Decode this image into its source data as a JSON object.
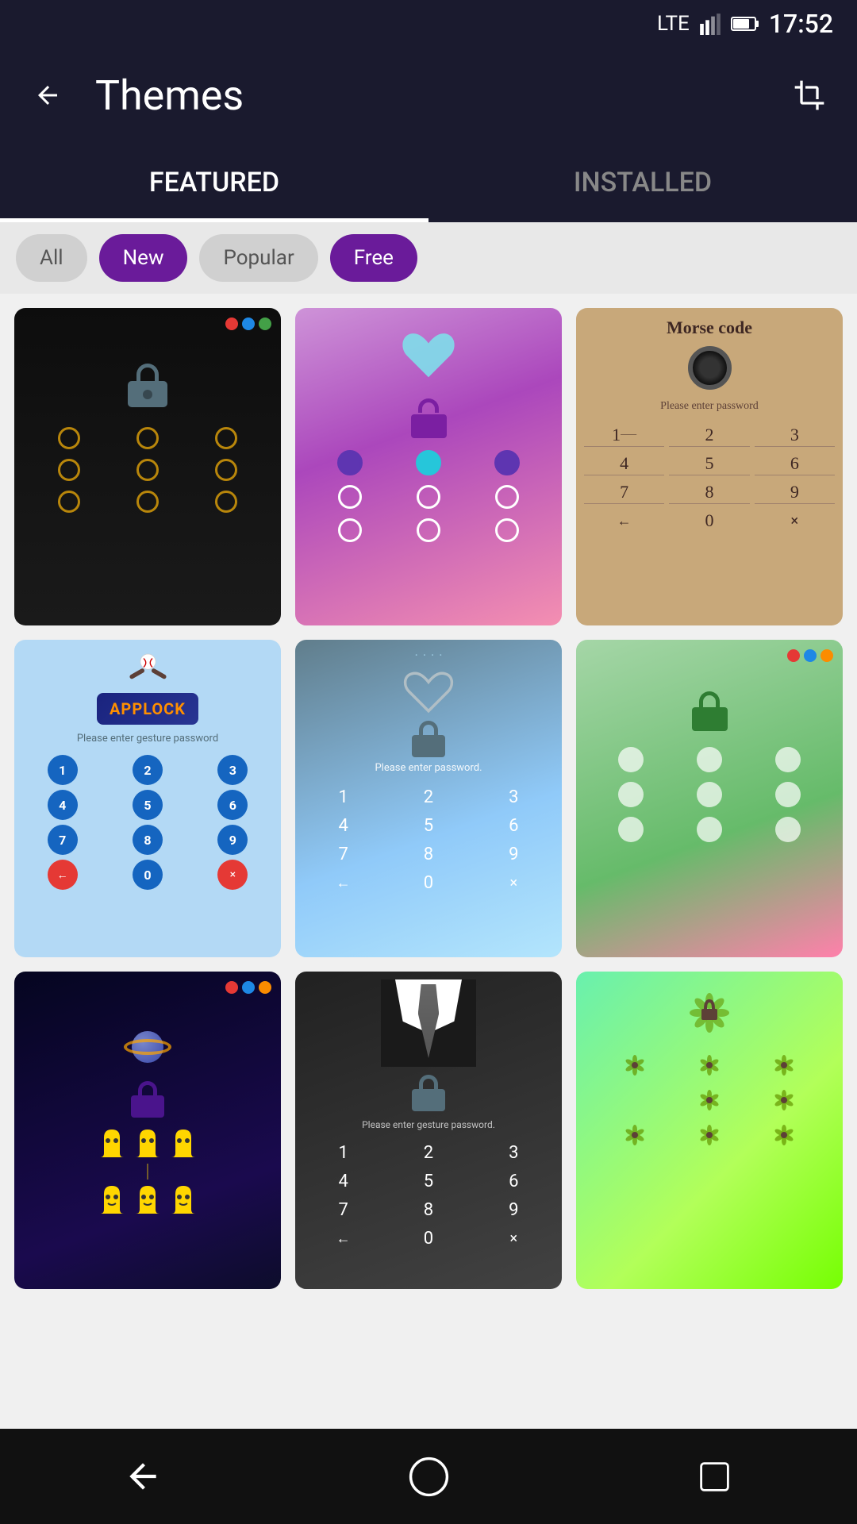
{
  "statusBar": {
    "signal": "LTE",
    "battery": "⚡",
    "time": "17:52"
  },
  "header": {
    "title": "Themes",
    "backIcon": "←",
    "cropIcon": "⊡"
  },
  "tabs": [
    {
      "id": "featured",
      "label": "FEATURED",
      "active": true
    },
    {
      "id": "installed",
      "label": "INSTALLED",
      "active": false
    }
  ],
  "subTabs": [
    {
      "id": "all",
      "label": "All",
      "active": false
    },
    {
      "id": "new",
      "label": "New",
      "active": true
    },
    {
      "id": "popular",
      "label": "Popular",
      "active": false
    },
    {
      "id": "free",
      "label": "Free",
      "active": true
    }
  ],
  "themes": [
    {
      "id": "dark-gold",
      "style": "tc-dark",
      "dotsColor": [
        "pip-red",
        "pip-blue",
        "pip-green"
      ],
      "type": "gesture"
    },
    {
      "id": "purple-heart",
      "style": "tc-purple",
      "type": "heart-gesture"
    },
    {
      "id": "vintage-morse",
      "style": "tc-vintage",
      "type": "numpad",
      "title": "Morse code"
    },
    {
      "id": "baseball",
      "style": "tc-baseball",
      "type": "numpad-circles"
    },
    {
      "id": "rainy-heart",
      "style": "tc-rainy",
      "type": "numpad",
      "passwordHint": "Please enter password."
    },
    {
      "id": "green-bubbles",
      "style": "tc-green-bubble",
      "dotsColor": [
        "pip-red",
        "pip-blue",
        "pip-orange"
      ],
      "type": "bubble-gesture"
    },
    {
      "id": "space-ghost",
      "style": "tc-space",
      "dotsColor": [
        "pip-red",
        "pip-blue",
        "pip-orange"
      ],
      "type": "ghost-gesture"
    },
    {
      "id": "suit",
      "style": "tc-suit",
      "type": "numpad",
      "passwordHint": "Please enter gesture password."
    },
    {
      "id": "green-mandala",
      "style": "tc-mandala",
      "type": "mandala-gesture"
    }
  ],
  "bottomNav": {
    "backIcon": "◁",
    "homeIcon": "○",
    "recentIcon": "□"
  }
}
